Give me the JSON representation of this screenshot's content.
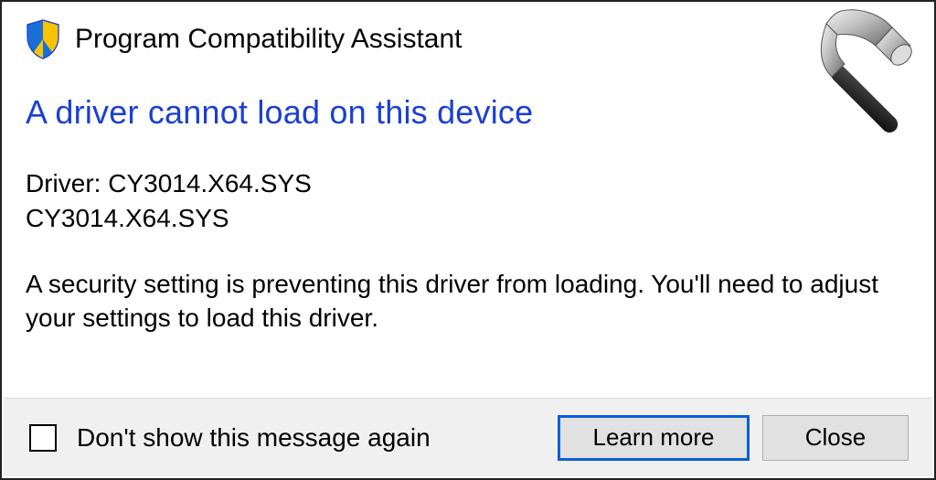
{
  "header": {
    "title": "Program Compatibility Assistant"
  },
  "main": {
    "heading": "A driver cannot load on this device",
    "driver_label": "Driver: CY3014.X64.SYS",
    "driver_name": "CY3014.X64.SYS",
    "body": "A security setting is preventing this driver from loading. You'll need to adjust your settings to load this driver."
  },
  "footer": {
    "checkbox_label": "Don't show this message again",
    "learn_more": "Learn more",
    "close": "Close"
  }
}
